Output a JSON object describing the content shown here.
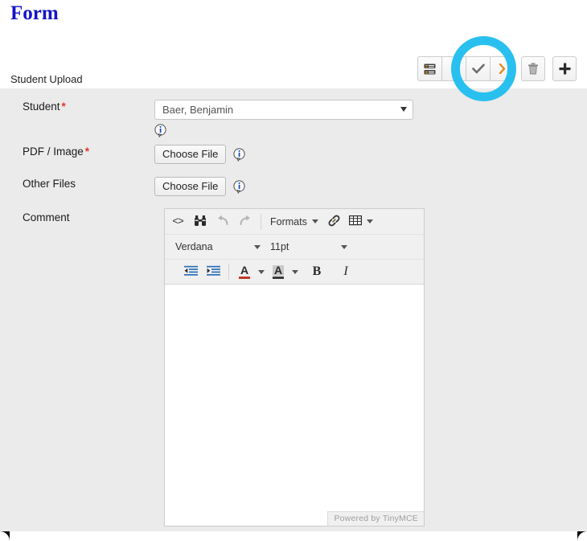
{
  "page": {
    "title": "Form",
    "title_color": "#1414c8",
    "panel_bg": "#ebebeb",
    "highlight_color": "#29c0ef",
    "required_marker": "*",
    "required_color": "#e8322a"
  },
  "toolbar": {
    "buttons": [
      {
        "name": "list-view-button",
        "icon": "list-database-icon",
        "label": ""
      },
      {
        "name": "previous-button",
        "icon": "chevron-left-icon",
        "label": ""
      },
      {
        "name": "save-button",
        "icon": "check-icon",
        "label": "",
        "highlighted": true
      },
      {
        "name": "next-button",
        "icon": "chevron-right-icon",
        "label": ""
      },
      {
        "name": "delete-button",
        "icon": "trash-icon",
        "label": ""
      },
      {
        "name": "add-button",
        "icon": "plus-icon",
        "label": ""
      }
    ]
  },
  "form": {
    "section_label": "Student Upload",
    "fields": [
      {
        "label": "Student",
        "required": true,
        "type": "select",
        "value": "Baer, Benjamin",
        "options": [
          "Baer, Benjamin"
        ],
        "info_icon": "info-icon"
      },
      {
        "label": "PDF / Image",
        "required": true,
        "type": "file",
        "button_label": "Choose File",
        "info_icon": "info-icon"
      },
      {
        "label": "Other Files",
        "required": false,
        "type": "file",
        "button_label": "Choose File",
        "info_icon": "info-icon"
      },
      {
        "label": "Comment",
        "required": false,
        "type": "richtext"
      }
    ]
  },
  "editor": {
    "toolbar_row1": [
      {
        "name": "source-code-button",
        "icon": "code-icon",
        "label": "<>"
      },
      {
        "name": "find-replace-button",
        "icon": "binoculars-icon",
        "label": ""
      },
      {
        "name": "undo-button",
        "icon": "undo-arrow-icon",
        "label": ""
      },
      {
        "name": "redo-button",
        "icon": "redo-arrow-icon",
        "label": ""
      },
      {
        "name": "formats-menu",
        "icon": "chevron-down-icon",
        "label": "Formats"
      },
      {
        "name": "insert-link-button",
        "icon": "link-icon",
        "label": ""
      },
      {
        "name": "table-menu",
        "icon": "table-icon",
        "label": ""
      }
    ],
    "font_family": "Verdana",
    "font_size": "11pt",
    "toolbar_row3": [
      {
        "name": "outdent-button",
        "icon": "outdent-icon",
        "label": ""
      },
      {
        "name": "indent-button",
        "icon": "indent-icon",
        "label": ""
      },
      {
        "name": "text-color-button",
        "icon": "text-color-a-icon",
        "label": "A"
      },
      {
        "name": "background-color-button",
        "icon": "highlight-a-icon",
        "label": "A"
      },
      {
        "name": "bold-button",
        "icon": "bold-icon",
        "label": "B"
      },
      {
        "name": "italic-button",
        "icon": "italic-icon",
        "label": "I"
      }
    ],
    "content": "",
    "status_text": "Powered by TinyMCE"
  }
}
